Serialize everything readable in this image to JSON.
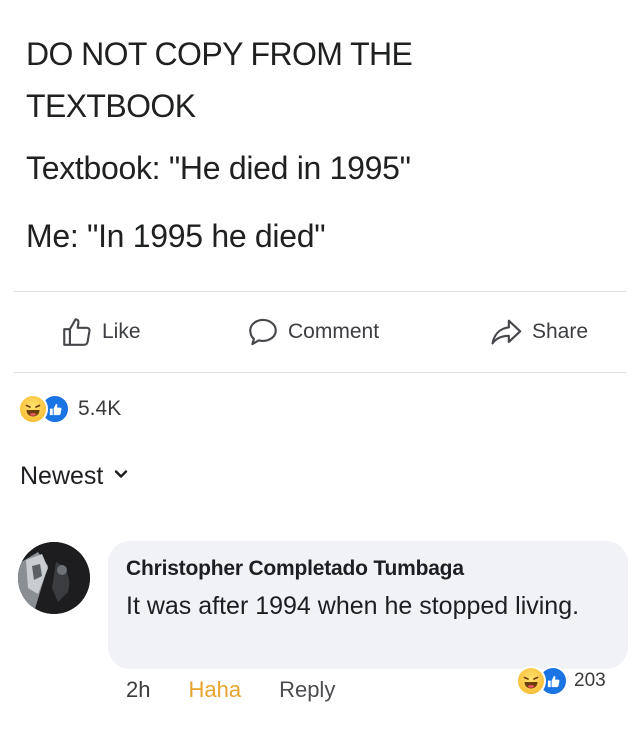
{
  "post": {
    "lines": [
      "DO NOT COPY FROM THE",
      "TEXTBOOK",
      "Textbook: \"He died in 1995\"",
      "Me: \"In 1995 he died\""
    ]
  },
  "actions": {
    "like": "Like",
    "comment": "Comment",
    "share": "Share"
  },
  "reactions": {
    "types": [
      "haha",
      "like"
    ],
    "count": "5.4K"
  },
  "sort": {
    "label": "Newest"
  },
  "comment": {
    "author": "Christopher Completado Tumbaga",
    "text": "It was after 1994 when he stopped living.",
    "time": "2h",
    "haha_label": "Haha",
    "reply_label": "Reply",
    "reaction_types": [
      "haha",
      "like"
    ],
    "reaction_count": "203"
  },
  "colors": {
    "haha_active": "#e6a42c",
    "like_blue": "#1b74e4",
    "bubble": "#f0f2f5"
  }
}
